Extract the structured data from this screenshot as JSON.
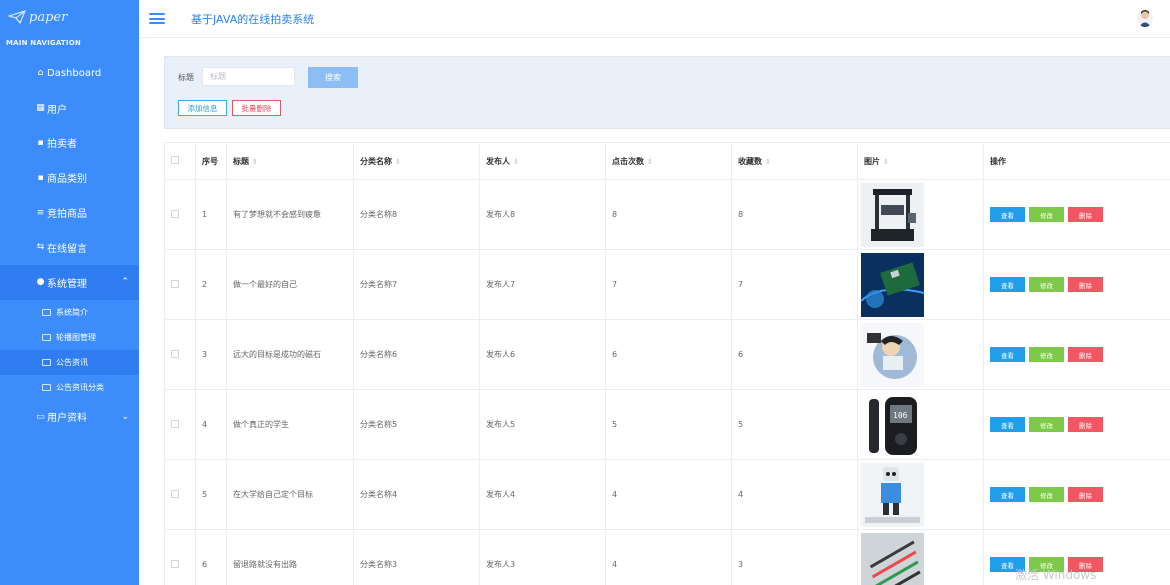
{
  "logo": {
    "text": "paper",
    "icon": "paper-plane-icon"
  },
  "nav_header": "MAIN NAVIGATION",
  "sidebar": {
    "items": [
      {
        "label": "Dashboard",
        "icon": "home-icon"
      },
      {
        "label": "用户",
        "icon": "grid-icon"
      },
      {
        "label": "拍卖者",
        "icon": "dots-grid-icon"
      },
      {
        "label": "商品类别",
        "icon": "dots-grid-icon"
      },
      {
        "label": "竞拍商品",
        "icon": "list-icon"
      },
      {
        "label": "在线留言",
        "icon": "exchange-icon"
      },
      {
        "label": "系统管理",
        "icon": "user-icon",
        "chevron": "⌃"
      }
    ],
    "sub_items": [
      {
        "label": "系统简介",
        "icon": "folder-icon"
      },
      {
        "label": "轮播图管理",
        "icon": "folder-icon"
      },
      {
        "label": "公告资讯",
        "icon": "folder-icon"
      },
      {
        "label": "公告资讯分类",
        "icon": "folder-icon"
      }
    ],
    "last_item": {
      "label": "用户资料",
      "icon": "card-icon",
      "chevron": "⌄"
    }
  },
  "header": {
    "title": "基于JAVA的在线拍卖系统"
  },
  "search": {
    "label": "标题",
    "placeholder": "标题",
    "button": "搜索",
    "add_button": "添加信息",
    "batch_delete_button": "批量删除"
  },
  "table": {
    "columns": [
      "序号",
      "标题",
      "分类名称",
      "发布人",
      "点击次数",
      "收藏数",
      "图片",
      "操作"
    ],
    "rows": [
      {
        "no": "1",
        "title": "有了梦想就不会感到疲惫",
        "category": "分类名称8",
        "publisher": "发布人8",
        "clicks": "8",
        "favorites": "8",
        "image": "machine"
      },
      {
        "no": "2",
        "title": "做一个最好的自己",
        "category": "分类名称7",
        "publisher": "发布人7",
        "clicks": "7",
        "favorites": "7",
        "image": "circuit"
      },
      {
        "no": "3",
        "title": "远大的目标是成功的磁石",
        "category": "分类名称6",
        "publisher": "发布人6",
        "clicks": "6",
        "favorites": "6",
        "image": "cartoon"
      },
      {
        "no": "4",
        "title": "做个真正的学生",
        "category": "分类名称5",
        "publisher": "发布人5",
        "clicks": "5",
        "favorites": "5",
        "image": "glucometer"
      },
      {
        "no": "5",
        "title": "在大学给自己定个目标",
        "category": "分类名称4",
        "publisher": "发布人4",
        "clicks": "4",
        "favorites": "4",
        "image": "robot"
      },
      {
        "no": "6",
        "title": "留退路就没有出路",
        "category": "分类名称3",
        "publisher": "发布人3",
        "clicks": "4",
        "favorites": "3",
        "image": "tools"
      }
    ],
    "actions": {
      "view": "查看",
      "edit": "修改",
      "delete": "删除"
    }
  },
  "watermark": "激活 Windows",
  "colors": {
    "sidebar": "#3c8dfb",
    "title": "#2a84e8",
    "view": "#1e9fe8",
    "edit": "#7ec84a",
    "delete": "#f15763"
  }
}
